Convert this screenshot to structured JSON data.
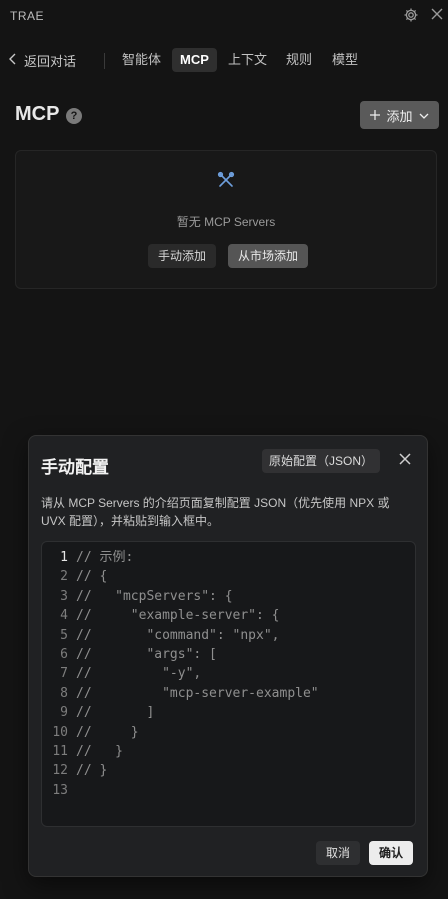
{
  "app": {
    "title": "TRAE"
  },
  "nav": {
    "back_label": "返回对话",
    "tabs": [
      {
        "label": "智能体",
        "active": false
      },
      {
        "label": "MCP",
        "active": true
      },
      {
        "label": "上下文",
        "active": false
      },
      {
        "label": "规则",
        "active": false
      },
      {
        "label": "模型",
        "active": false
      }
    ]
  },
  "header": {
    "title": "MCP",
    "help_glyph": "?",
    "add_label": "添加"
  },
  "empty_state": {
    "text": "暂无 MCP Servers",
    "manual_add_label": "手动添加",
    "market_add_label": "从市场添加"
  },
  "modal": {
    "title": "手动配置",
    "raw_config_label": "原始配置（JSON）",
    "description": "请从 MCP Servers 的介绍页面复制配置 JSON（优先使用 NPX 或 UVX 配置），并粘贴到输入框中。",
    "code_lines": [
      "// 示例:",
      "// {",
      "//   \"mcpServers\": {",
      "//     \"example-server\": {",
      "//       \"command\": \"npx\",",
      "//       \"args\": [",
      "//         \"-y\",",
      "//         \"mcp-server-example\"",
      "//       ]",
      "//     }",
      "//   }",
      "// }",
      ""
    ],
    "current_line": 1,
    "cancel_label": "取消",
    "confirm_label": "确认"
  },
  "icons": {
    "settings": "gear-icon",
    "close_window": "close-icon",
    "back": "chevron-left-icon",
    "help": "question-circle-icon",
    "add": "plus-icon",
    "add_caret": "chevron-down-icon",
    "empty": "tools-icon",
    "modal_close": "close-icon"
  },
  "colors": {
    "accent_icon": "#6e9fdc",
    "confirm_button": "#ececec"
  }
}
